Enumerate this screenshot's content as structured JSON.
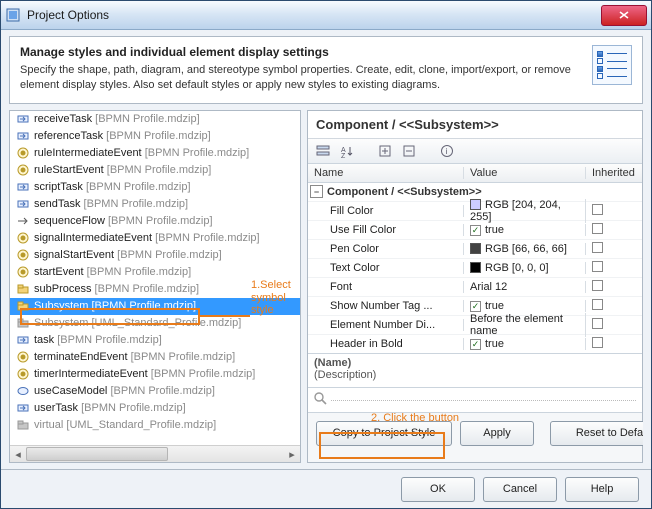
{
  "window": {
    "title": "Project Options"
  },
  "header": {
    "title": "Manage styles and individual element display settings",
    "description": "Specify the shape, path, diagram, and stereotype symbol properties. Create, edit, clone, import/export, or remove element display styles. Also set default styles or apply new styles to existing diagrams."
  },
  "tree": {
    "items": [
      {
        "icon": "arrow",
        "name": "receiveTask",
        "sub": "BPMN Profile.mdzip"
      },
      {
        "icon": "arrow",
        "name": "referenceTask",
        "sub": "BPMN Profile.mdzip"
      },
      {
        "icon": "event",
        "name": "ruleIntermediateEvent",
        "sub": "BPMN Profile.mdzip"
      },
      {
        "icon": "event",
        "name": "ruleStartEvent",
        "sub": "BPMN Profile.mdzip"
      },
      {
        "icon": "arrow",
        "name": "scriptTask",
        "sub": "BPMN Profile.mdzip"
      },
      {
        "icon": "arrow",
        "name": "sendTask",
        "sub": "BPMN Profile.mdzip"
      },
      {
        "icon": "flow",
        "name": "sequenceFlow",
        "sub": "BPMN Profile.mdzip"
      },
      {
        "icon": "event",
        "name": "signalIntermediateEvent",
        "sub": "BPMN Profile.mdzip"
      },
      {
        "icon": "event",
        "name": "signalStartEvent",
        "sub": "BPMN Profile.mdzip"
      },
      {
        "icon": "event",
        "name": "startEvent",
        "sub": "BPMN Profile.mdzip"
      },
      {
        "icon": "folder",
        "name": "subProcess",
        "sub": "BPMN Profile.mdzip"
      },
      {
        "icon": "folder",
        "name": "Subsystem",
        "sub": "BPMN Profile.mdzip",
        "selected": true
      },
      {
        "icon": "folder-gray",
        "name": "Subsystem",
        "sub": "UML_Standard_Profile.mdzip",
        "muted": true
      },
      {
        "icon": "arrow",
        "name": "task",
        "sub": "BPMN Profile.mdzip"
      },
      {
        "icon": "event",
        "name": "terminateEndEvent",
        "sub": "BPMN Profile.mdzip"
      },
      {
        "icon": "event",
        "name": "timerIntermediateEvent",
        "sub": "BPMN Profile.mdzip"
      },
      {
        "icon": "case",
        "name": "useCaseModel",
        "sub": "BPMN Profile.mdzip"
      },
      {
        "icon": "arrow",
        "name": "userTask",
        "sub": "BPMN Profile.mdzip"
      },
      {
        "icon": "folder-gray",
        "name": "virtual",
        "sub": "UML_Standard_Profile.mdzip",
        "muted": true
      }
    ]
  },
  "panel": {
    "title": "Component / <<Subsystem>>",
    "columns": {
      "name": "Name",
      "value": "Value",
      "inherited": "Inherited"
    },
    "group": "Component / <<Subsystem>>",
    "rows": [
      {
        "name": "Fill Color",
        "type": "color",
        "swatch": "#ccccff",
        "value": "RGB [204, 204, 255]"
      },
      {
        "name": "Use Fill Color",
        "type": "check",
        "checked": true,
        "value": "true"
      },
      {
        "name": "Pen Color",
        "type": "color",
        "swatch": "#424242",
        "value": "RGB [66, 66, 66]"
      },
      {
        "name": "Text Color",
        "type": "color",
        "swatch": "#000000",
        "value": "RGB [0, 0, 0]"
      },
      {
        "name": "Font",
        "type": "text",
        "value": "Arial 12"
      },
      {
        "name": "Show Number Tag ...",
        "type": "check",
        "checked": true,
        "value": "true"
      },
      {
        "name": "Element Number Di...",
        "type": "text",
        "value": "Before the element name"
      },
      {
        "name": "Header in Bold",
        "type": "check",
        "checked": true,
        "value": "true"
      }
    ],
    "desc": {
      "name": "(Name)",
      "text": "(Description)"
    },
    "buttons": {
      "copy": "Copy to Project Style",
      "apply": "Apply",
      "reset": "Reset to Defaults"
    }
  },
  "footer": {
    "ok": "OK",
    "cancel": "Cancel",
    "help": "Help"
  },
  "annotations": {
    "a1": "1.Select symbol style",
    "a2": "2. Click the button"
  }
}
